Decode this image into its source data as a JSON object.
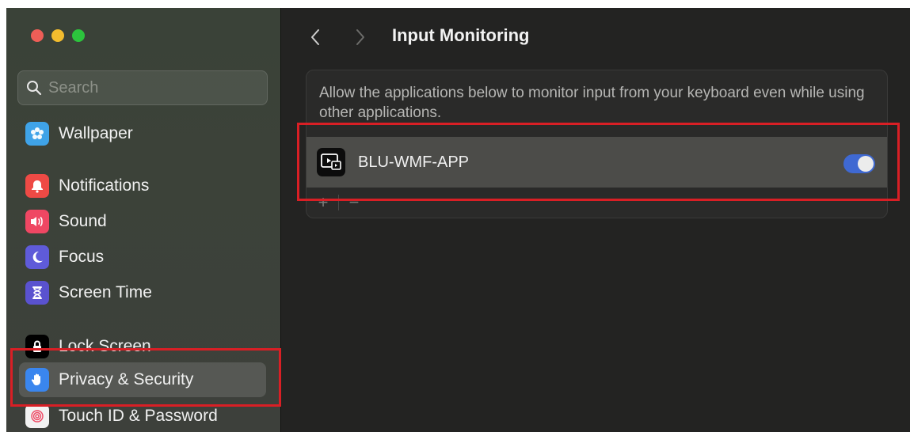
{
  "window": {
    "title": "Input Monitoring"
  },
  "sidebar": {
    "search_placeholder": "Search",
    "items": [
      {
        "label": "Wallpaper",
        "icon": "wallpaper-icon",
        "color": "#3fa3e8"
      },
      {
        "label": "Notifications",
        "icon": "notifications-icon",
        "color": "#ee4a45"
      },
      {
        "label": "Sound",
        "icon": "sound-icon",
        "color": "#ef4763"
      },
      {
        "label": "Focus",
        "icon": "focus-icon",
        "color": "#5f5bd9"
      },
      {
        "label": "Screen Time",
        "icon": "screen-time-icon",
        "color": "#5a52cf"
      },
      {
        "label": "Lock Screen",
        "icon": "lock-screen-icon",
        "color": "#000000"
      },
      {
        "label": "Privacy & Security",
        "icon": "privacy-hand-icon",
        "color": "#3a86ee",
        "selected": true
      },
      {
        "label": "Touch ID & Password",
        "icon": "touch-id-icon",
        "color": "#f2f2f2"
      }
    ]
  },
  "main": {
    "title": "Input Monitoring",
    "description": "Allow the applications below to monitor input from your keyboard even while using other applications.",
    "apps": [
      {
        "name": "BLU-WMF-APP",
        "enabled": true
      }
    ],
    "add_label": "+",
    "remove_label": "−"
  },
  "colors": {
    "accent": "#3f69d2",
    "highlight_box": "#d91f25"
  }
}
